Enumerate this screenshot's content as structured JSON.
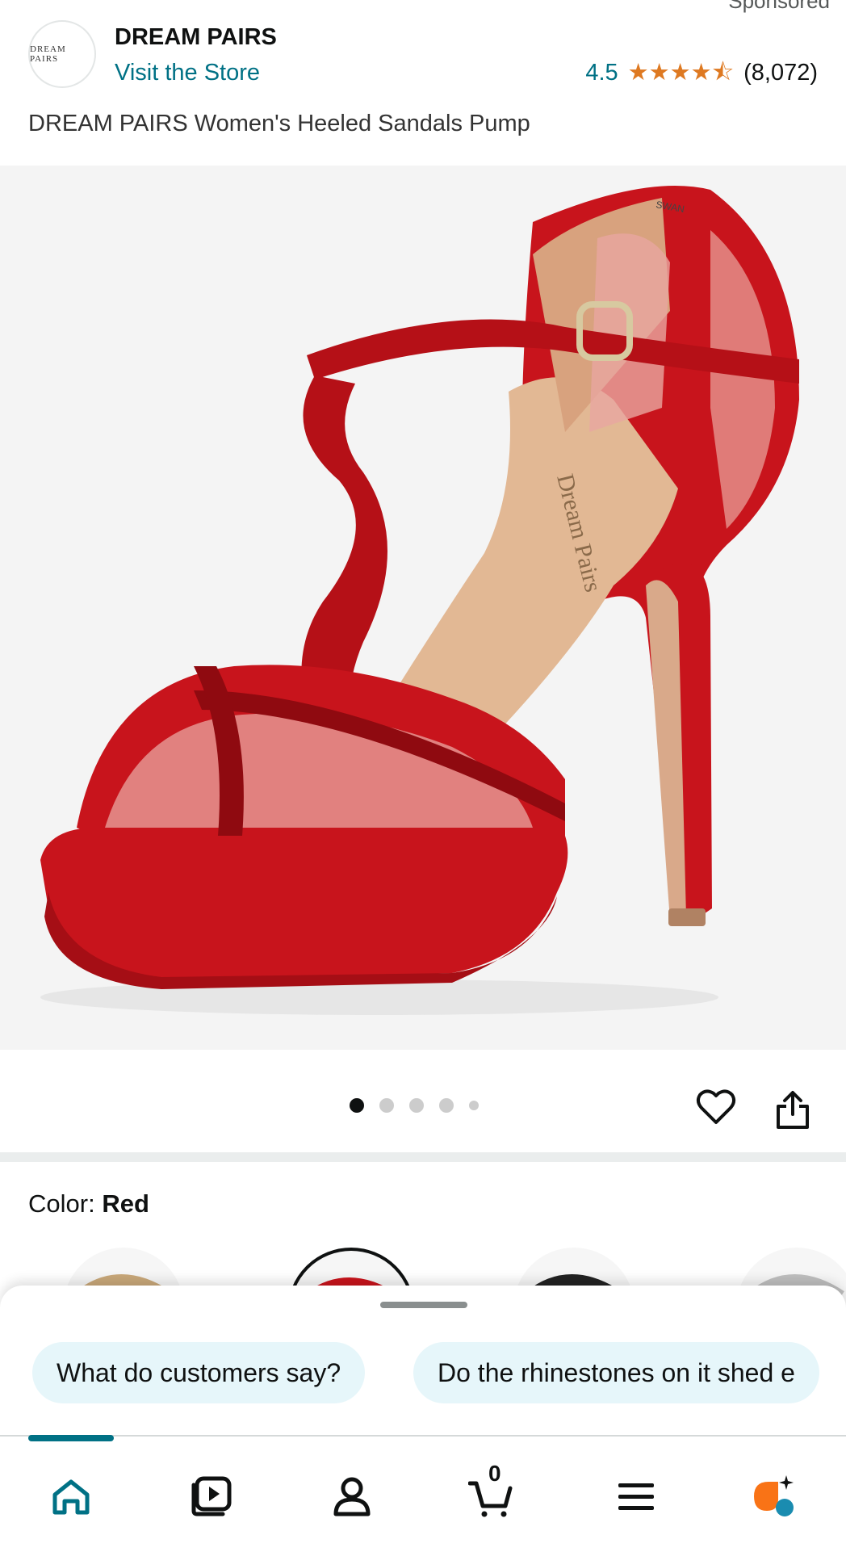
{
  "header": {
    "sponsored": "Sponsored",
    "brand_logo_text": "DREAM PAIRS",
    "brand_name": "DREAM PAIRS",
    "visit_store": "Visit the Store",
    "rating_value": "4.5",
    "rating_stars": 4.5,
    "review_count": "(8,072)",
    "product_title": "DREAM PAIRS Women's Heeled Sandals Pump"
  },
  "product_image": {
    "insole_text": "Dream Pairs",
    "label_text": "SWAN"
  },
  "carousel": {
    "image_count": 5,
    "active_index": 0
  },
  "color": {
    "label": "Color: ",
    "value": "Red"
  },
  "bottom_sheet": {
    "chips": [
      "What do customers say?",
      "Do the rhinestones on it shed e"
    ]
  },
  "nav": {
    "cart_count": "0",
    "items": [
      "home-icon",
      "video-icon",
      "account-icon",
      "cart-icon",
      "menu-icon",
      "rufus-icon"
    ]
  },
  "colors": {
    "accent": "#007185",
    "star": "#de7921",
    "chip_bg": "#e6f6fa",
    "shoe_red": "#c8141c"
  }
}
